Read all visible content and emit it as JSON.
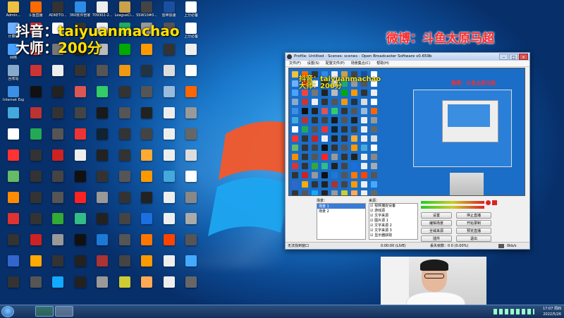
{
  "overlay": {
    "line1_prefix": "抖音：",
    "line1_name": "taiyuanmachao",
    "line2_prefix": "大师：",
    "line2_value": "200分",
    "weibo": "微博：斗鱼太原马超"
  },
  "desktop_icons": [
    {
      "label": "Admin...",
      "color": "#f0c040"
    },
    {
      "label": "斗鱼直播",
      "color": "#ff6a00"
    },
    {
      "label": "ADKETO...",
      "color": "#333"
    },
    {
      "label": "360软件管家",
      "color": "#2e8be6"
    },
    {
      "label": "709302-2...",
      "color": "#eee"
    },
    {
      "label": "LeagueCl...",
      "color": "#c9a24a"
    },
    {
      "label": "SSW10#0...",
      "color": "#444"
    },
    {
      "label": "雷神加速",
      "color": "#1a4fa0"
    },
    {
      "label": "上分必备",
      "color": "#fff"
    },
    {
      "label": "计算机",
      "color": "#6fb0ff"
    },
    {
      "label": "",
      "color": "#d33"
    },
    {
      "label": "",
      "color": "#fff"
    },
    {
      "label": "",
      "color": "#333"
    },
    {
      "label": "",
      "color": "#eee"
    },
    {
      "label": "",
      "color": "#2a6"
    },
    {
      "label": "",
      "color": "#999"
    },
    {
      "label": "",
      "color": "#555"
    },
    {
      "label": "上分必备",
      "color": "#fff"
    },
    {
      "label": "网络",
      "color": "#4aa3ff"
    },
    {
      "label": "",
      "color": "#e44"
    },
    {
      "label": "",
      "color": "#777"
    },
    {
      "label": "",
      "color": "#222"
    },
    {
      "label": "",
      "color": "#bbb"
    },
    {
      "label": "",
      "color": "#0a0"
    },
    {
      "label": "",
      "color": "#f90"
    },
    {
      "label": "",
      "color": "#333"
    },
    {
      "label": "",
      "color": "#eee"
    },
    {
      "label": "回收站",
      "color": "#8ac"
    },
    {
      "label": "",
      "color": "#c33"
    },
    {
      "label": "",
      "color": "#eee"
    },
    {
      "label": "",
      "color": "#333"
    },
    {
      "label": "",
      "color": "#555"
    },
    {
      "label": "",
      "color": "#e91"
    },
    {
      "label": "",
      "color": "#234"
    },
    {
      "label": "",
      "color": "#ddd"
    },
    {
      "label": "",
      "color": "#fff"
    },
    {
      "label": "Internet Explorer",
      "color": "#3b8fe6"
    },
    {
      "label": "",
      "color": "#111"
    },
    {
      "label": "",
      "color": "#222"
    },
    {
      "label": "",
      "color": "#d55"
    },
    {
      "label": "",
      "color": "#3c6"
    },
    {
      "label": "",
      "color": "#333"
    },
    {
      "label": "",
      "color": "#555"
    },
    {
      "label": "",
      "color": "#9bd"
    },
    {
      "label": "",
      "color": "#f60"
    },
    {
      "label": "",
      "color": "#4ad"
    },
    {
      "label": "",
      "color": "#b33"
    },
    {
      "label": "",
      "color": "#333"
    },
    {
      "label": "",
      "color": "#444"
    },
    {
      "label": "",
      "color": "#1a1a1a"
    },
    {
      "label": "",
      "color": "#555"
    },
    {
      "label": "",
      "color": "#222"
    },
    {
      "label": "",
      "color": "#eee"
    },
    {
      "label": "",
      "color": "#999"
    },
    {
      "label": "",
      "color": "#fff"
    },
    {
      "label": "",
      "color": "#2a5"
    },
    {
      "label": "",
      "color": "#555"
    },
    {
      "label": "",
      "color": "#e33"
    },
    {
      "label": "",
      "color": "#123"
    },
    {
      "label": "",
      "color": "#333"
    },
    {
      "label": "",
      "color": "#444"
    },
    {
      "label": "",
      "color": "#eee"
    },
    {
      "label": "",
      "color": "#666"
    },
    {
      "label": "",
      "color": "#f33"
    },
    {
      "label": "",
      "color": "#333"
    },
    {
      "label": "",
      "color": "#c22"
    },
    {
      "label": "",
      "color": "#eee"
    },
    {
      "label": "",
      "color": "#222"
    },
    {
      "label": "",
      "color": "#333"
    },
    {
      "label": "",
      "color": "#fa3"
    },
    {
      "label": "",
      "color": "#eee"
    },
    {
      "label": "",
      "color": "#ddd"
    },
    {
      "label": "",
      "color": "#6b6"
    },
    {
      "label": "",
      "color": "#333"
    },
    {
      "label": "",
      "color": "#444"
    },
    {
      "label": "",
      "color": "#111"
    },
    {
      "label": "",
      "color": "#333"
    },
    {
      "label": "",
      "color": "#555"
    },
    {
      "label": "",
      "color": "#f90"
    },
    {
      "label": "",
      "color": "#4ad"
    },
    {
      "label": "",
      "color": "#fff"
    },
    {
      "label": "",
      "color": "#ff8c00"
    },
    {
      "label": "",
      "color": "#333"
    },
    {
      "label": "",
      "color": "#555"
    },
    {
      "label": "",
      "color": "#f22"
    },
    {
      "label": "",
      "color": "#999"
    },
    {
      "label": "",
      "color": "#333"
    },
    {
      "label": "",
      "color": "#222"
    },
    {
      "label": "",
      "color": "#eee"
    },
    {
      "label": "",
      "color": "#888"
    },
    {
      "label": "",
      "color": "#d33"
    },
    {
      "label": "",
      "color": "#333"
    },
    {
      "label": "",
      "color": "#3a3"
    },
    {
      "label": "",
      "color": "#3b8"
    },
    {
      "label": "",
      "color": "#222"
    },
    {
      "label": "",
      "color": "#444"
    },
    {
      "label": "",
      "color": "#1b6fe0"
    },
    {
      "label": "",
      "color": "#eee"
    },
    {
      "label": "",
      "color": "#aaa"
    },
    {
      "label": "",
      "color": "#333"
    },
    {
      "label": "",
      "color": "#c22"
    },
    {
      "label": "",
      "color": "#999"
    },
    {
      "label": "",
      "color": "#111"
    },
    {
      "label": "",
      "color": "#1d79d6"
    },
    {
      "label": "",
      "color": "#555"
    },
    {
      "label": "",
      "color": "#f70"
    },
    {
      "label": "",
      "color": "#f40"
    },
    {
      "label": "",
      "color": "#555"
    },
    {
      "label": "",
      "color": "#36c"
    },
    {
      "label": "",
      "color": "#fa0"
    },
    {
      "label": "",
      "color": "#333"
    },
    {
      "label": "",
      "color": "#222"
    },
    {
      "label": "",
      "color": "#a33"
    },
    {
      "label": "",
      "color": "#444"
    },
    {
      "label": "",
      "color": "#f90"
    },
    {
      "label": "",
      "color": "#eee"
    },
    {
      "label": "",
      "color": "#4af"
    },
    {
      "label": "",
      "color": "#333"
    },
    {
      "label": "",
      "color": "#555"
    },
    {
      "label": "",
      "color": "#1af"
    },
    {
      "label": "",
      "color": "#222"
    },
    {
      "label": "",
      "color": "#999"
    },
    {
      "label": "",
      "color": "#cc3"
    },
    {
      "label": "",
      "color": "#fa5"
    },
    {
      "label": "",
      "color": "#eee"
    },
    {
      "label": "",
      "color": "#666"
    }
  ],
  "obs": {
    "title": "Profile: Untitled - Scenes: scenes - Open Broadcaster Software v0.659b",
    "menu": [
      "文件(F)",
      "设置(S)",
      "配置文件(P)",
      "场景集合(C)",
      "帮助(H)"
    ],
    "preview_line1": "抖音：taiyuanmachao",
    "preview_line2": "大师：200分",
    "preview_weibo": "微博：斗鱼太原马超",
    "scenes_label": "场景：",
    "scenes": [
      "场景 1",
      "场景 2"
    ],
    "sources_label": "来源：",
    "sources": [
      "视频捕捉设备",
      "游戏源",
      "文字来源",
      "图片源 1",
      "文字来源 2",
      "文字来源 3",
      "显示器获取"
    ],
    "buttons": [
      "设置",
      "停止直播",
      "编辑场景",
      "开始录制",
      "全域来源",
      "预览直播",
      "插件",
      "退出"
    ],
    "status_left": "无法找到窗口",
    "status_time": "0:00:00 (LIVE)",
    "status_drop": "丢失帧数：0  0 (0.00%)",
    "status_rate": "0kb/s"
  },
  "tray": {
    "time": "17:07 周四",
    "date": "2022/5/26"
  }
}
